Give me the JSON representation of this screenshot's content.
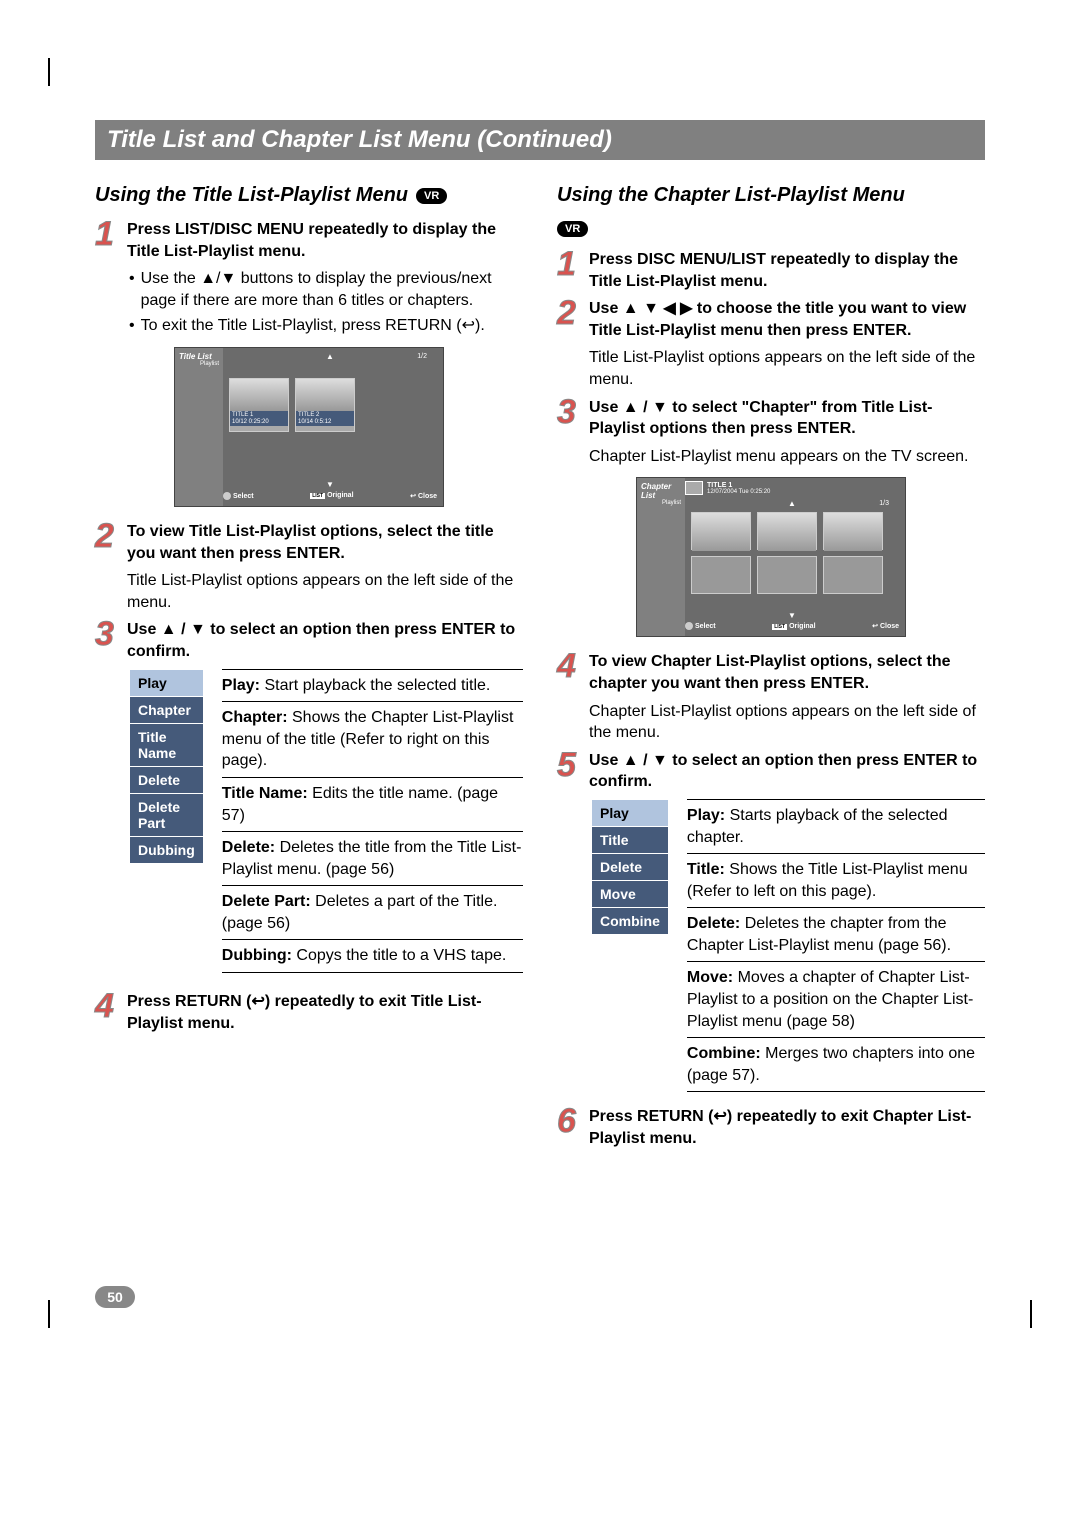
{
  "page_title": "Title List and Chapter List Menu (Continued)",
  "page_number": "50",
  "badge_vr": "VR",
  "left": {
    "heading": "Using the Title List-Playlist Menu",
    "step1_bold": "Press LIST/DISC MENU repeatedly to display the Title List-Playlist menu.",
    "step1_bullet1": "Use the ▲/▼ buttons to display the previous/next page if there are more than 6 titles or chapters.",
    "step1_bullet2": "To exit the Title List-Playlist, press RETURN (↩).",
    "screen": {
      "side_title": "Title List",
      "side_sub": "Playlist",
      "page_indicator": "1/2",
      "thumb1_title": "TITLE 1",
      "thumb1_meta": "10/12    0:25:20",
      "thumb2_title": "TITLE 2",
      "thumb2_meta": "10/14    0:5:12",
      "bottom_select": "Select",
      "bottom_list": "LIST",
      "bottom_list_label": "Original",
      "bottom_close": "Close"
    },
    "step2_bold": "To view Title List-Playlist options, select the title you want then press ENTER.",
    "step2_text": "Title List-Playlist options appears on the left side of the menu.",
    "step3_bold": "Use ▲ / ▼ to select an option then press ENTER to confirm.",
    "menu": [
      "Play",
      "Chapter",
      "Title Name",
      "Delete",
      "Delete Part",
      "Dubbing"
    ],
    "defs": [
      {
        "term": "Play:",
        "text": " Start playback the selected title."
      },
      {
        "term": "Chapter:",
        "text": " Shows the Chapter List-Playlist menu of the title (Refer to right on this page)."
      },
      {
        "term": "Title Name:",
        "text": " Edits the title name. (page 57)"
      },
      {
        "term": "Delete:",
        "text": " Deletes the title from the Title List-Playlist  menu. (page 56)"
      },
      {
        "term": "Delete Part:",
        "text": " Deletes a part of the Title. (page 56)"
      },
      {
        "term": "Dubbing:",
        "text": " Copys the title to a VHS tape."
      }
    ],
    "step4_bold": "Press RETURN (↩) repeatedly to exit Title List-Playlist menu."
  },
  "right": {
    "heading": "Using the Chapter List-Playlist Menu",
    "step1_bold": "Press DISC MENU/LIST repeatedly to display the Title List-Playlist menu.",
    "step2_bold": "Use ▲ ▼ ◀ ▶ to choose the title you want to view Title List-Playlist menu then press ENTER.",
    "step2_text": "Title List-Playlist options appears on the left side of the menu.",
    "step3_bold": "Use ▲ / ▼ to select \"Chapter\" from Title List-Playlist options then press ENTER.",
    "step3_text": "Chapter List-Playlist menu appears on the TV screen.",
    "screen": {
      "side_title": "Chapter List",
      "side_sub": "Playlist",
      "top_title": "TITLE 1",
      "top_meta": "12/07/2004  Tue 0:25:20",
      "page_indicator": "1/3",
      "bottom_select": "Select",
      "bottom_list": "LIST",
      "bottom_list_label": "Original",
      "bottom_close": "Close"
    },
    "step4_bold": "To view Chapter List-Playlist options, select the chapter you want then press ENTER.",
    "step4_text": "Chapter List-Playlist options appears on the left side of the menu.",
    "step5_bold": "Use ▲ / ▼ to select an option then press ENTER to confirm.",
    "menu": [
      "Play",
      "Title",
      "Delete",
      "Move",
      "Combine"
    ],
    "defs": [
      {
        "term": "Play:",
        "text": " Starts playback of the selected chapter."
      },
      {
        "term": "Title:",
        "text": " Shows the Title List-Playlist menu (Refer to left on this page)."
      },
      {
        "term": "Delete:",
        "text": " Deletes the chapter from the Chapter List-Playlist menu (page 56)."
      },
      {
        "term": "Move:",
        "text": " Moves a chapter of Chapter List-Playlist to a position on the Chapter List-Playlist menu (page 58)"
      },
      {
        "term": "Combine:",
        "text": " Merges two chapters into one (page 57)."
      }
    ],
    "step6_bold": "Press RETURN (↩) repeatedly to exit Chapter List-Playlist menu."
  },
  "nums": {
    "n1": "1",
    "n2": "2",
    "n3": "3",
    "n4": "4",
    "n5": "5",
    "n6": "6"
  },
  "arrows": {
    "up": "▲",
    "down": "▼"
  }
}
